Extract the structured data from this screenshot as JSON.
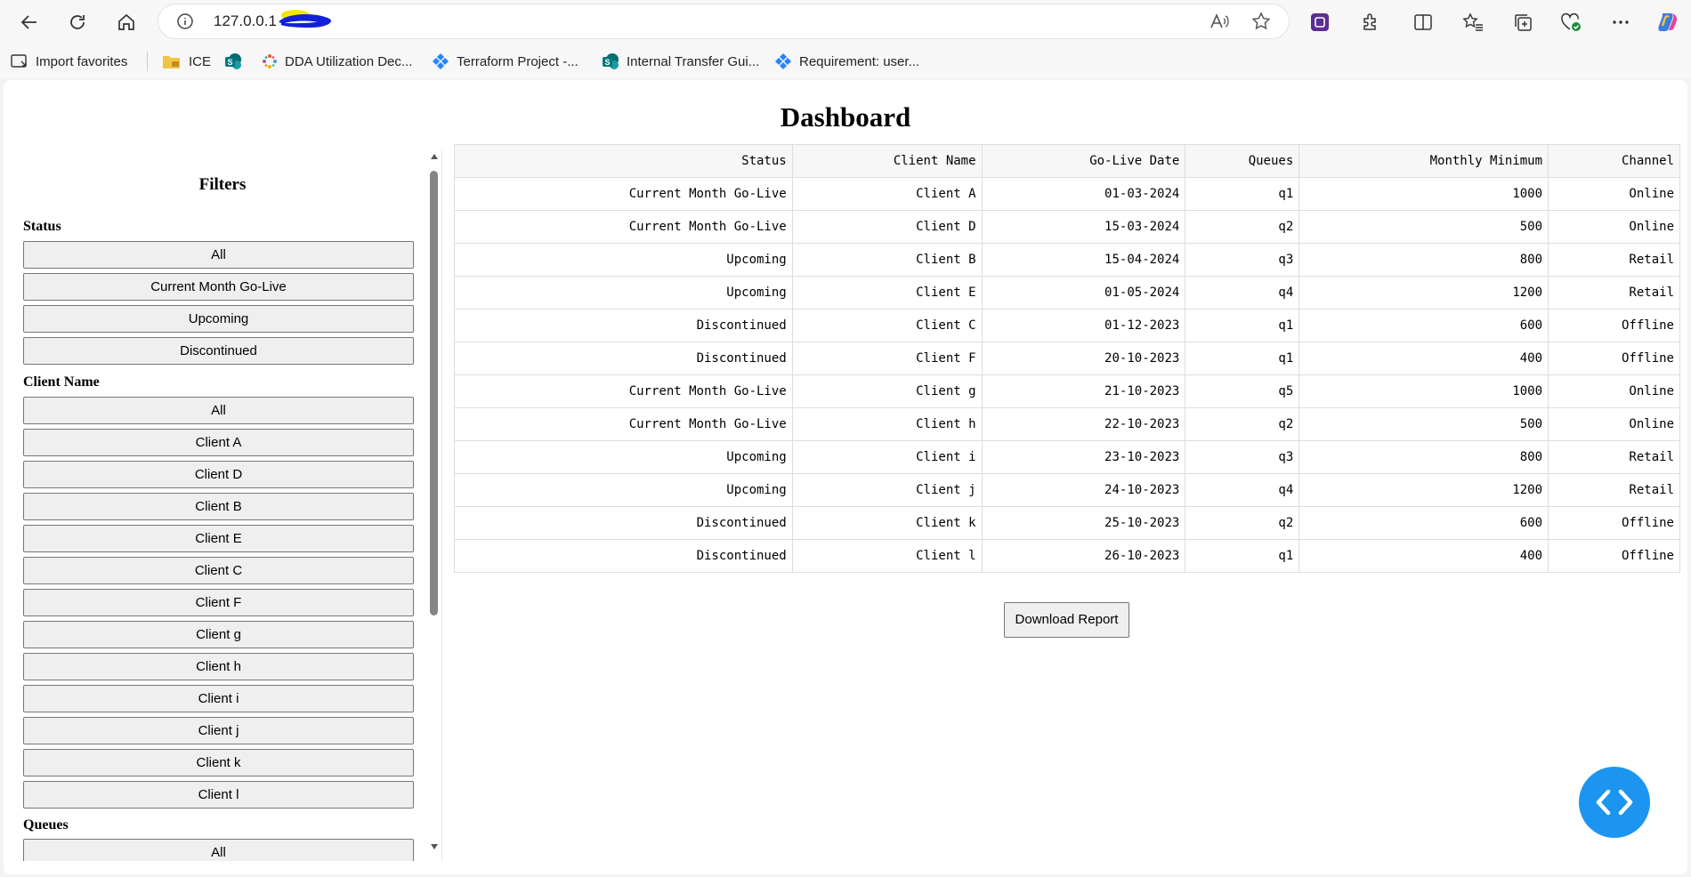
{
  "browser": {
    "url": "127.0.0.1",
    "bookmarks": [
      {
        "label": "Import favorites",
        "icon": "import-icon"
      },
      {
        "label": "ICE",
        "icon": "folder-icon"
      },
      {
        "label": "",
        "icon": "sharepoint-icon"
      },
      {
        "label": "DDA Utilization Dec...",
        "icon": "dots-logo-icon"
      },
      {
        "label": "Terraform Project -...",
        "icon": "jira-icon"
      },
      {
        "label": "Internal Transfer Gui...",
        "icon": "sharepoint-icon"
      },
      {
        "label": "Requirement: user...",
        "icon": "jira-icon"
      }
    ]
  },
  "page": {
    "title": "Dashboard",
    "filters": {
      "heading": "Filters",
      "status": {
        "label": "Status",
        "options": [
          "All",
          "Current Month Go-Live",
          "Upcoming",
          "Discontinued"
        ]
      },
      "client_name": {
        "label": "Client Name",
        "options": [
          "All",
          "Client A",
          "Client D",
          "Client B",
          "Client E",
          "Client C",
          "Client F",
          "Client g",
          "Client h",
          "Client i",
          "Client j",
          "Client k",
          "Client l"
        ]
      },
      "queues": {
        "label": "Queues",
        "options": [
          "All"
        ]
      }
    },
    "table": {
      "columns": [
        "Status",
        "Client Name",
        "Go-Live Date",
        "Queues",
        "Monthly Minimum",
        "Channel"
      ],
      "rows": [
        [
          "Current Month Go-Live",
          "Client A",
          "01-03-2024",
          "q1",
          "1000",
          "Online"
        ],
        [
          "Current Month Go-Live",
          "Client D",
          "15-03-2024",
          "q2",
          "500",
          "Online"
        ],
        [
          "Upcoming",
          "Client B",
          "15-04-2024",
          "q3",
          "800",
          "Retail"
        ],
        [
          "Upcoming",
          "Client E",
          "01-05-2024",
          "q4",
          "1200",
          "Retail"
        ],
        [
          "Discontinued",
          "Client C",
          "01-12-2023",
          "q1",
          "600",
          "Offline"
        ],
        [
          "Discontinued",
          "Client F",
          "20-10-2023",
          "q1",
          "400",
          "Offline"
        ],
        [
          "Current Month Go-Live",
          "Client g",
          "21-10-2023",
          "q5",
          "1000",
          "Online"
        ],
        [
          "Current Month Go-Live",
          "Client h",
          "22-10-2023",
          "q2",
          "500",
          "Online"
        ],
        [
          "Upcoming",
          "Client i",
          "23-10-2023",
          "q3",
          "800",
          "Retail"
        ],
        [
          "Upcoming",
          "Client j",
          "24-10-2023",
          "q4",
          "1200",
          "Retail"
        ],
        [
          "Discontinued",
          "Client k",
          "25-10-2023",
          "q2",
          "600",
          "Offline"
        ],
        [
          "Discontinued",
          "Client l",
          "26-10-2023",
          "q1",
          "400",
          "Offline"
        ]
      ]
    },
    "download_label": "Download Report"
  },
  "colors": {
    "fab": "#1b95f0",
    "page_bg": "#ffffff",
    "chrome_bg": "#f7f7f7"
  }
}
